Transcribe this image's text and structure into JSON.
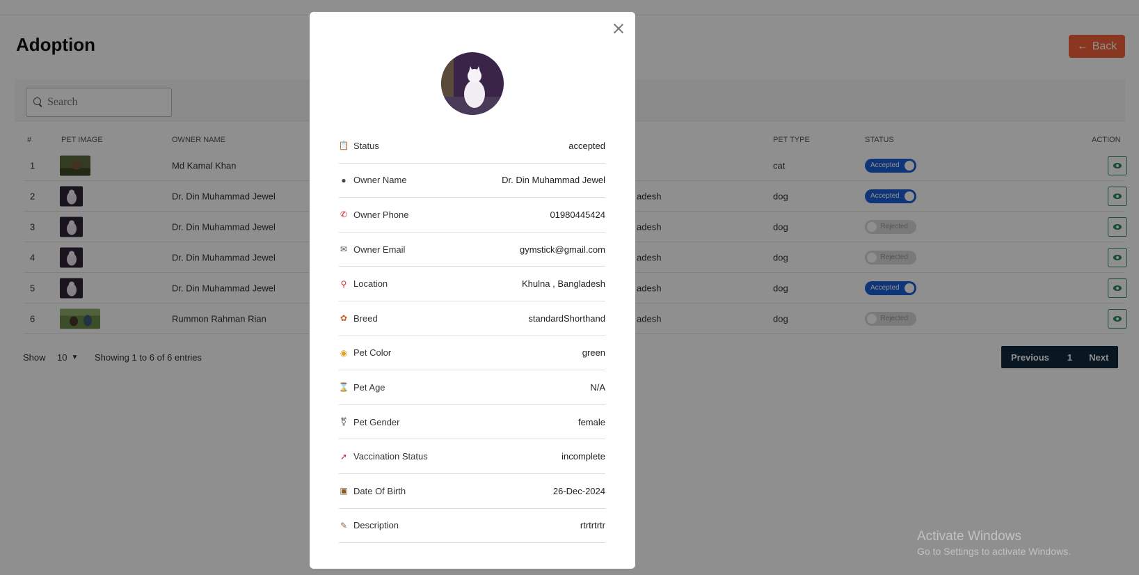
{
  "page": {
    "title": "Adoption",
    "back_label": "Back",
    "search_placeholder": "Search"
  },
  "table": {
    "columns": [
      "#",
      "PET IMAGE",
      "OWNER NAME",
      "PET TYPE",
      "STATUS",
      "ACTION"
    ],
    "rows": [
      {
        "num": "1",
        "owner": "Md Kamal Khan",
        "location": "",
        "type": "cat",
        "status": "Accepted",
        "on": true
      },
      {
        "num": "2",
        "owner": "Dr. Din Muhammad Jewel",
        "location": "adesh",
        "type": "dog",
        "status": "Accepted",
        "on": true
      },
      {
        "num": "3",
        "owner": "Dr. Din Muhammad Jewel",
        "location": "adesh",
        "type": "dog",
        "status": "Rejected",
        "on": false
      },
      {
        "num": "4",
        "owner": "Dr. Din Muhammad Jewel",
        "location": "adesh",
        "type": "dog",
        "status": "Rejected",
        "on": false
      },
      {
        "num": "5",
        "owner": "Dr. Din Muhammad Jewel",
        "location": "adesh",
        "type": "dog",
        "status": "Accepted",
        "on": true
      },
      {
        "num": "6",
        "owner": "Rummon Rahman Rian",
        "location": "adesh",
        "type": "dog",
        "status": "Rejected",
        "on": false
      }
    ]
  },
  "footer": {
    "show_label": "Show",
    "page_size": "10",
    "info": "Showing 1 to 6 of 6 entries",
    "prev_label": "Previous",
    "page_num": "1",
    "next_label": "Next"
  },
  "modal": {
    "details": [
      {
        "label": "Status",
        "value": "accepted",
        "icon": "clipboard-icon"
      },
      {
        "label": "Owner Name",
        "value": "Dr. Din Muhammad Jewel",
        "icon": "person-icon"
      },
      {
        "label": "Owner Phone",
        "value": "01980445424",
        "icon": "phone-icon"
      },
      {
        "label": "Owner Email",
        "value": "gymstick@gmail.com",
        "icon": "envelope-icon"
      },
      {
        "label": "Location",
        "value": "Khulna , Bangladesh",
        "icon": "pin-icon"
      },
      {
        "label": "Breed",
        "value": "standardShorthand",
        "icon": "paw-icon"
      },
      {
        "label": "Pet Color",
        "value": "green",
        "icon": "palette-icon"
      },
      {
        "label": "Pet Age",
        "value": "N/A",
        "icon": "hourglass-icon"
      },
      {
        "label": "Pet Gender",
        "value": "female",
        "icon": "gender-icon"
      },
      {
        "label": "Vaccination Status",
        "value": "incomplete",
        "icon": "syringe-icon"
      },
      {
        "label": "Date Of Birth",
        "value": "26-Dec-2024",
        "icon": "cake-icon"
      },
      {
        "label": "Description",
        "value": "rtrtrtrtr",
        "icon": "memo-icon"
      }
    ]
  },
  "watermark": {
    "line1": "Activate Windows",
    "line2": "Go to Settings to activate Windows."
  },
  "colors": {
    "accent_back": "#f4623a",
    "toggle_on": "#1c5fd6",
    "pager_bg": "#0f2a3d",
    "action_green": "#2e8b57"
  }
}
